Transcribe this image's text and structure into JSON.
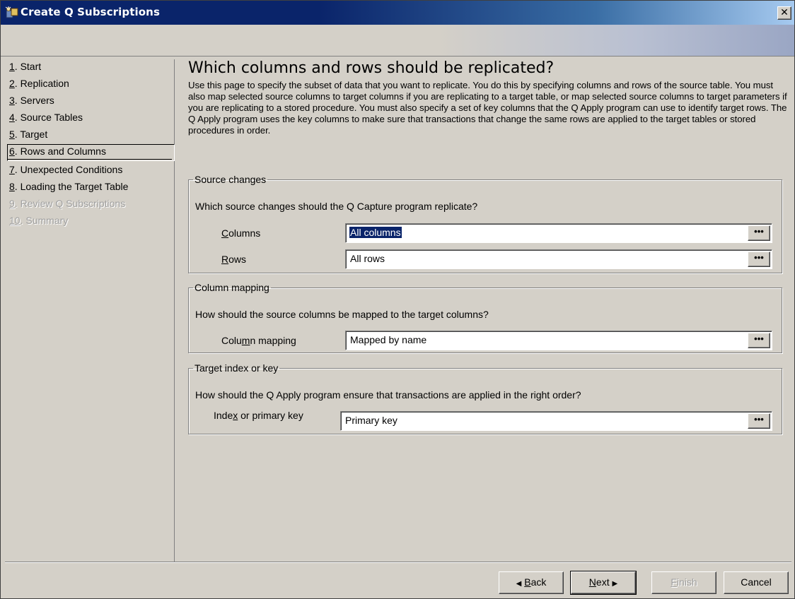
{
  "window": {
    "title": "Create Q Subscriptions",
    "close_glyph": "✕"
  },
  "nav": {
    "items": [
      {
        "num": "1",
        "rest": ". Start",
        "state": "normal"
      },
      {
        "num": "2",
        "rest": ". Replication",
        "state": "normal"
      },
      {
        "num": "3",
        "rest": ". Servers",
        "state": "normal"
      },
      {
        "num": "4",
        "rest": ". Source Tables",
        "state": "normal"
      },
      {
        "num": "5",
        "rest": ". Target",
        "state": "normal"
      },
      {
        "num": "6",
        "rest": ". Rows and Columns",
        "state": "selected"
      },
      {
        "num": "7",
        "rest": ". Unexpected Conditions",
        "state": "normal"
      },
      {
        "num": "8",
        "rest": ". Loading the Target Table",
        "state": "normal"
      },
      {
        "num": "9",
        "rest": ". Review Q Subscriptions",
        "state": "disabled"
      },
      {
        "num": "10",
        "rest": ". Summary",
        "state": "disabled"
      }
    ]
  },
  "main": {
    "title": "Which columns and rows should be replicated?",
    "intro": "Use this page to specify the subset of data that you want to replicate. You do this by specifying columns and rows of the source table. You must also map selected source columns to target columns if you are replicating to a target table, or map selected source columns to target parameters if you are replicating to a stored procedure. You must also specify a set of key columns that the Q Apply program can use to identify target rows. The Q Apply program uses the key columns to make sure that transactions that change the same rows are applied to the target tables or stored procedures in order.",
    "source_changes": {
      "legend": "Source changes",
      "question": "Which source changes should the Q Capture program replicate?",
      "columns_label_key": "C",
      "columns_label_rest": "olumns",
      "columns_value": "All columns",
      "rows_label_key": "R",
      "rows_label_rest": "ows",
      "rows_value": "All rows"
    },
    "column_mapping": {
      "legend": "Column mapping",
      "question": "How should the source columns be mapped to the target columns?",
      "label_pre": "Colu",
      "label_key": "m",
      "label_post": "n mapping",
      "value": "Mapped by name"
    },
    "target_index": {
      "legend": "Target index or key",
      "question": "How should the Q Apply program ensure that transactions are applied in the right order?",
      "label_pre": "Inde",
      "label_key": "x",
      "label_post": " or primary key",
      "value": "Primary key"
    },
    "ellipsis": "•••"
  },
  "footer": {
    "back_arrow": "◀",
    "back_key": "B",
    "back_rest": "ack",
    "next_key": "N",
    "next_rest": "ext",
    "next_arrow": "▶",
    "finish_key": "F",
    "finish_rest": "inish",
    "cancel": "Cancel"
  },
  "colors": {
    "title_bar": "#0a246a",
    "face": "#d4d0c8",
    "selection": "#0a246a"
  }
}
